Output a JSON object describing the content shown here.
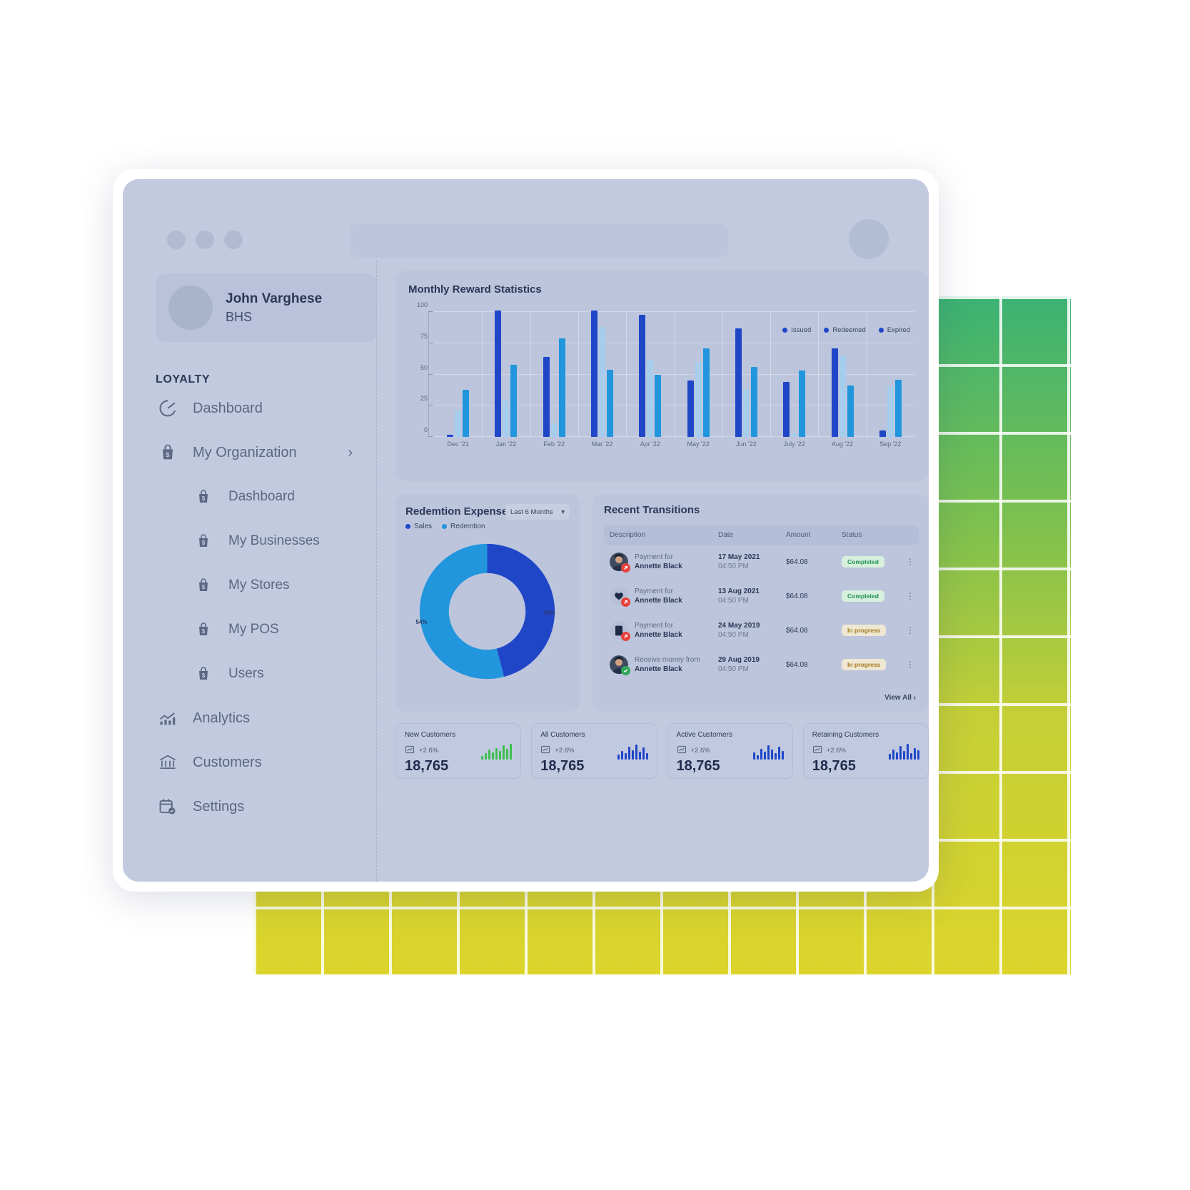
{
  "window": {
    "traffic_lights": [
      "close",
      "minimize",
      "maximize"
    ],
    "omnibox_placeholder": ""
  },
  "sidebar": {
    "user": {
      "name": "John Varghese",
      "org": "BHS"
    },
    "section_label": "LOYALTY",
    "items": [
      {
        "label": "Dashboard",
        "icon": "speedometer-icon",
        "level": 0,
        "chevron": ""
      },
      {
        "label": "My Organization",
        "icon": "bag-dollar-icon",
        "level": 0,
        "chevron": "›"
      },
      {
        "label": "Dashboard",
        "icon": "bag-dollar-icon",
        "level": 1,
        "chevron": ""
      },
      {
        "label": "My Businesses",
        "icon": "bag-dollar-icon",
        "level": 1,
        "chevron": ""
      },
      {
        "label": "My Stores",
        "icon": "bag-dollar-icon",
        "level": 1,
        "chevron": ""
      },
      {
        "label": "My POS",
        "icon": "bag-dollar-icon",
        "level": 1,
        "chevron": ""
      },
      {
        "label": "Users",
        "icon": "bag-dollar-icon",
        "level": 1,
        "chevron": ""
      },
      {
        "label": "Analytics",
        "icon": "analytics-bars-icon",
        "level": 0,
        "chevron": ""
      },
      {
        "label": "Customers",
        "icon": "bank-icon",
        "level": 0,
        "chevron": ""
      },
      {
        "label": "Settings",
        "icon": "calendar-check-icon",
        "level": 0,
        "chevron": ""
      }
    ]
  },
  "chart_data": [
    {
      "type": "bar",
      "title": "Monthly Reward Statistics",
      "xlabel": "",
      "ylabel": "",
      "ylim": [
        0,
        100
      ],
      "yticks": [
        0,
        25,
        50,
        75,
        100
      ],
      "grid": true,
      "legend_position": "top-right",
      "categories": [
        "Dec '21",
        "Jan '22",
        "Feb '22",
        "Mar '22",
        "Apr '22",
        "May '22",
        "Jun '22",
        "July '22",
        "Aug '22",
        "Sep '22"
      ],
      "series": [
        {
          "name": "Issued",
          "color": "#2046c8",
          "values": [
            2,
            101,
            64,
            101,
            98,
            45,
            87,
            44,
            71,
            5
          ]
        },
        {
          "name": "Redeemed",
          "color": "#a7cdec",
          "values": [
            21,
            29,
            11,
            88,
            62,
            60,
            38,
            3,
            65,
            40
          ]
        },
        {
          "name": "Expired",
          "color": "#2196dd",
          "values": [
            38,
            58,
            79,
            54,
            50,
            71,
            56,
            53,
            41,
            46
          ]
        }
      ]
    },
    {
      "type": "pie",
      "title": "Redemtion Expense",
      "period": "Last 6 Months",
      "period_options": [
        "Last 6 Months"
      ],
      "legend_position": "top-left",
      "labels": [
        "Sales",
        "Redemtion"
      ],
      "values": [
        46,
        54
      ],
      "value_labels": [
        "46%",
        "54%"
      ],
      "colors": [
        "#2046c8",
        "#2196dd"
      ],
      "donut": true
    }
  ],
  "transactions": {
    "title": "Recent Transitions",
    "columns": [
      "Description",
      "Date",
      "Amount",
      "Status"
    ],
    "rows": [
      {
        "icon": "person-avatar-icon",
        "badge": "arrow-up-right-icon",
        "badge_color": "#e8413c",
        "desc_line1": "Payment for",
        "desc_line2": "Annette Black",
        "date": "17 May 2021",
        "time": "04:50 PM",
        "amount": "$64.08",
        "status": "Completed",
        "status_color": "#1f9254",
        "status_bg": "#d7f0de"
      },
      {
        "icon": "heart-icon",
        "badge": "arrow-up-right-icon",
        "badge_color": "#e8413c",
        "desc_line1": "Payment for",
        "desc_line2": "Annette Black",
        "date": "13 Aug 2021",
        "time": "04:50 PM",
        "amount": "$64.08",
        "status": "Completed",
        "status_color": "#1f9254",
        "status_bg": "#d7f0de"
      },
      {
        "icon": "book-icon",
        "badge": "arrow-up-right-icon",
        "badge_color": "#e8413c",
        "desc_line1": "Payment for",
        "desc_line2": "Annette Black",
        "date": "24 May 2019",
        "time": "04:50 PM",
        "amount": "$64.08",
        "status": "In progress",
        "status_color": "#a07a1d",
        "status_bg": "#efe7d2"
      },
      {
        "icon": "person-avatar-icon",
        "badge": "check-circle-icon",
        "badge_color": "#2fa65a",
        "desc_line1": "Receive money from",
        "desc_line2": "Annette Black",
        "date": "29 Aug 2019",
        "time": "04:50 PM",
        "amount": "$64.08",
        "status": "In progress",
        "status_color": "#a07a1d",
        "status_bg": "#efe7d2"
      }
    ],
    "view_all": "View All",
    "view_all_chevron": "›",
    "row_menu_glyph": "⋮"
  },
  "stats": [
    {
      "title": "New Customers",
      "delta": "+2.6%",
      "value": "18,765",
      "spark_color": "#3dbf4f",
      "bars": [
        5,
        9,
        14,
        10,
        16,
        12,
        20,
        15,
        22
      ]
    },
    {
      "title": "All Customers",
      "delta": "+2.6%",
      "value": "18,765",
      "spark_color": "#2046c8",
      "bars": [
        7,
        12,
        9,
        18,
        13,
        21,
        11,
        17,
        9
      ]
    },
    {
      "title": "Active Customers",
      "delta": "+2.6%",
      "value": "18,765",
      "spark_color": "#2046c8",
      "bars": [
        10,
        6,
        15,
        11,
        20,
        14,
        9,
        18,
        12
      ]
    },
    {
      "title": "Retaining Customers",
      "delta": "+2.6%",
      "value": "18,765",
      "spark_color": "#2046c8",
      "bars": [
        8,
        14,
        10,
        19,
        12,
        22,
        9,
        16,
        13
      ]
    }
  ],
  "colors": {
    "accent_dark_blue": "#2046c8",
    "accent_blue": "#2196dd",
    "accent_light_blue": "#a7cdec",
    "window_bg": "#c2cadf",
    "card_bg": "#bcc5dc"
  }
}
